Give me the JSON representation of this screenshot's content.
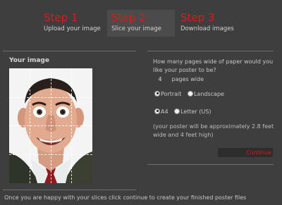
{
  "steps": [
    {
      "title": "Step 1",
      "subtitle": "Upload your image"
    },
    {
      "title": "Step 2",
      "subtitle": "Slice your image"
    },
    {
      "title": "Step 3",
      "subtitle": "Download images"
    }
  ],
  "left_panel": {
    "title": "Your image"
  },
  "right_panel": {
    "question": "How many pages wide of paper would you like your poster to be?",
    "pages_value": "4",
    "pages_label": "pages wide",
    "orientation": {
      "portrait": "Portrait",
      "landscape": "Landscape",
      "selected": "Portrait"
    },
    "paper": {
      "a4": "A4",
      "letter": "Letter (US)",
      "selected": "A4"
    },
    "note": "(your poster will be approximately 2.8 feet wide and 4 feet high)",
    "continue_label": "Continue"
  },
  "footer": "Once you are happy with your slices click continue to create your finished poster files",
  "colors": {
    "background": "#3e3e3e",
    "accent_red": "#d81b1b",
    "active_step_bg": "#4b4b4b"
  }
}
